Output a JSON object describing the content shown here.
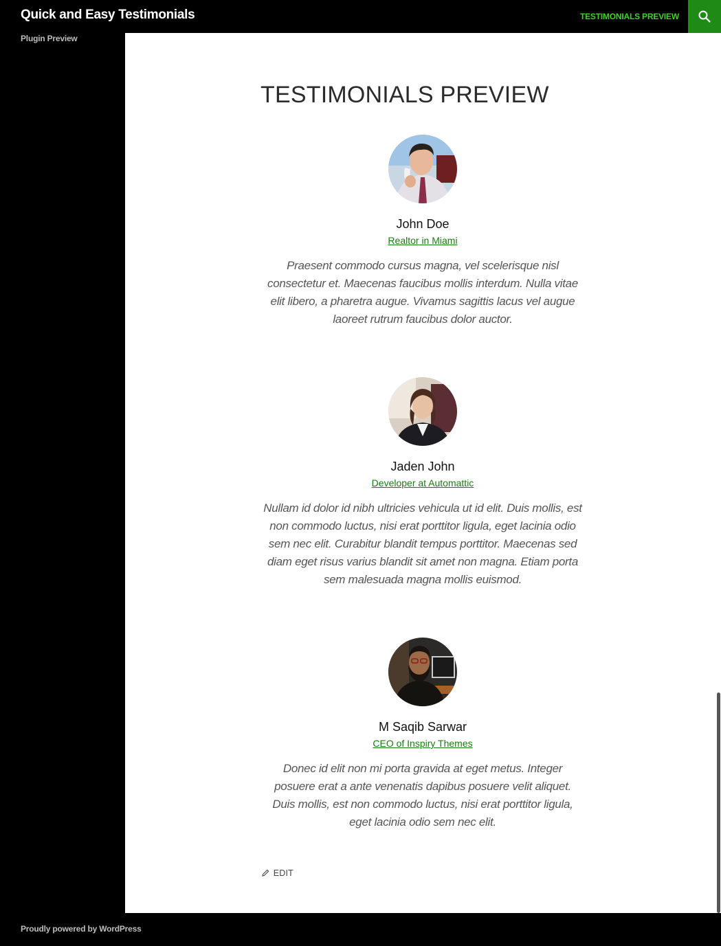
{
  "header": {
    "site_title": "Quick and Easy Testimonials",
    "nav_item": "TESTIMONIALS PREVIEW",
    "search_icon": "search-icon",
    "site_description": "Plugin Preview"
  },
  "main": {
    "page_title": "TESTIMONIALS PREVIEW",
    "testimonials": [
      {
        "name": "John Doe",
        "role": "Realtor in Miami",
        "quote": "Praesent commodo cursus magna, vel scelerisque nisl consectetur et. Maecenas faucibus mollis interdum. Nulla vitae elit libero, a pharetra augue. Vivamus sagittis lacus vel augue laoreet rutrum faucibus dolor auctor."
      },
      {
        "name": "Jaden John",
        "role": "Developer at Automattic",
        "quote": "Nullam id dolor id nibh ultricies vehicula ut id elit. Duis mollis, est non commodo luctus, nisi erat porttitor ligula, eget lacinia odio sem nec elit. Curabitur blandit tempus porttitor. Maecenas sed diam eget risus varius blandit sit amet non magna. Etiam porta sem malesuada magna mollis euismod."
      },
      {
        "name": "M Saqib Sarwar",
        "role": "CEO of Inspiry Themes",
        "quote": "Donec id elit non mi porta gravida at eget metus. Integer posuere erat a ante venenatis dapibus posuere velit aliquet. Duis mollis, est non commodo luctus, nisi erat porttitor ligula, eget lacinia odio sem nec elit."
      }
    ],
    "edit_label": "EDIT"
  },
  "footer": {
    "text": "Proudly powered by WordPress"
  },
  "colors": {
    "accent_green": "#41d12a",
    "link_green": "#1a7a12",
    "search_bg": "#1f8a16"
  }
}
